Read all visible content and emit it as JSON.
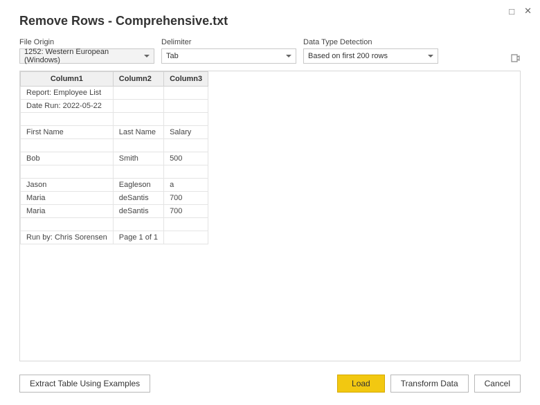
{
  "window": {
    "maximize_glyph": "□",
    "close_glyph": "✕"
  },
  "title": "Remove Rows - Comprehensive.txt",
  "options": {
    "file_origin": {
      "label": "File Origin",
      "value": "1252: Western European (Windows)"
    },
    "delimiter": {
      "label": "Delimiter",
      "value": "Tab"
    },
    "detection": {
      "label": "Data Type Detection",
      "value": "Based on first 200 rows"
    }
  },
  "table": {
    "headers": [
      "Column1",
      "Column2",
      "Column3"
    ],
    "rows": [
      [
        "Report: Employee List",
        "",
        ""
      ],
      [
        "Date Run: 2022-05-22",
        "",
        ""
      ],
      [
        "",
        "",
        ""
      ],
      [
        "First Name",
        "Last Name",
        "Salary"
      ],
      [
        "",
        "",
        ""
      ],
      [
        "Bob",
        "Smith",
        "500"
      ],
      [
        "",
        "",
        ""
      ],
      [
        "Jason",
        "Eagleson",
        "a"
      ],
      [
        "Maria",
        "deSantis",
        "700"
      ],
      [
        "Maria",
        "deSantis",
        "700"
      ],
      [
        "",
        "",
        ""
      ],
      [
        "Run by: Chris Sorensen",
        "Page 1 of 1",
        ""
      ]
    ]
  },
  "footer": {
    "extract": "Extract Table Using Examples",
    "load": "Load",
    "transform": "Transform Data",
    "cancel": "Cancel"
  }
}
